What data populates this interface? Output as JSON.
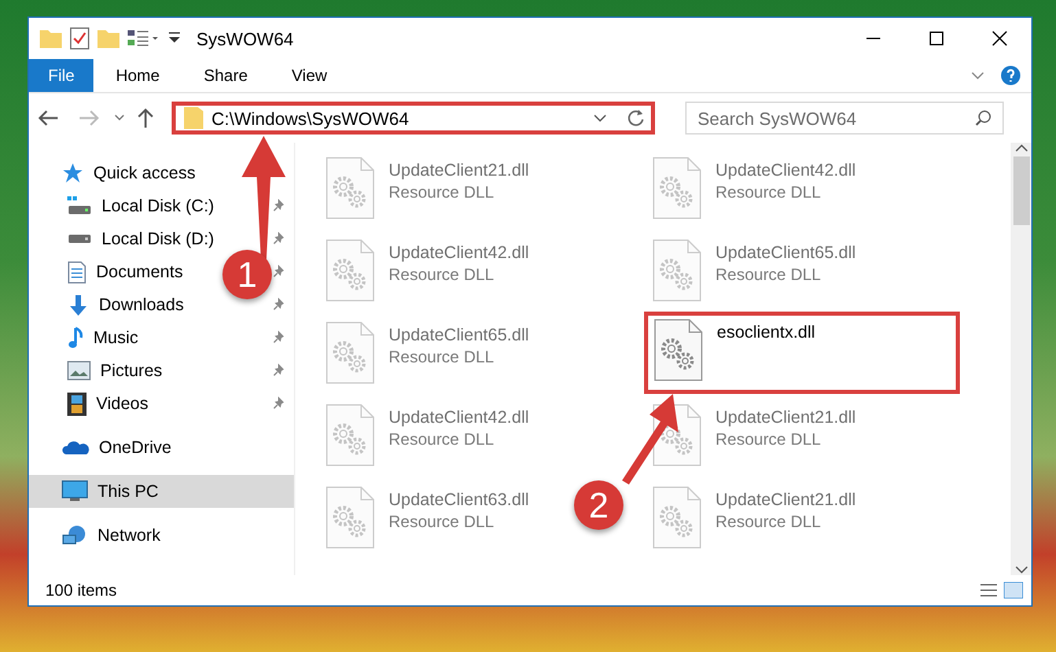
{
  "window": {
    "title": "SysWOW64"
  },
  "ribbon_tabs": [
    {
      "label": "File",
      "kind": "file"
    },
    {
      "label": "Home",
      "kind": "tab"
    },
    {
      "label": "Share",
      "kind": "tab"
    },
    {
      "label": "View",
      "kind": "tab"
    }
  ],
  "address": {
    "path": "C:\\Windows\\SysWOW64",
    "highlighted": true
  },
  "search": {
    "placeholder": "Search SysWOW64"
  },
  "sidebar": {
    "items": [
      {
        "label": "Quick access",
        "selected": false,
        "children": [
          {
            "label": "Local Disk (C:)",
            "pinned": true,
            "selected": false
          },
          {
            "label": "Local Disk (D:)",
            "pinned": true,
            "selected": false
          },
          {
            "label": "Documents",
            "pinned": true,
            "selected": false
          },
          {
            "label": "Downloads",
            "pinned": true,
            "selected": false
          },
          {
            "label": "Music",
            "pinned": true,
            "selected": false
          },
          {
            "label": "Pictures",
            "pinned": true,
            "selected": false
          },
          {
            "label": "Videos",
            "pinned": true,
            "selected": false
          }
        ]
      },
      {
        "label": "OneDrive",
        "selected": false
      },
      {
        "label": "This PC",
        "selected": true
      },
      {
        "label": "Network",
        "selected": false
      }
    ]
  },
  "files": [
    {
      "name": "UpdateClient21.dll",
      "type": "Resource DLL",
      "faded": true,
      "highlighted": false
    },
    {
      "name": "UpdateClient42.dll",
      "type": "Resource DLL",
      "faded": true,
      "highlighted": false
    },
    {
      "name": "UpdateClient42.dll",
      "type": "Resource DLL",
      "faded": true,
      "highlighted": false
    },
    {
      "name": "UpdateClient65.dll",
      "type": "Resource DLL",
      "faded": true,
      "highlighted": false
    },
    {
      "name": "UpdateClient65.dll",
      "type": "Resource DLL",
      "faded": true,
      "highlighted": false
    },
    {
      "name": "esoclientx.dll",
      "faded": false,
      "highlighted": true
    },
    {
      "name": "UpdateClient42.dll",
      "type": "Resource DLL",
      "faded": true,
      "highlighted": false
    },
    {
      "name": "UpdateClient21.dll",
      "type": "Resource DLL",
      "faded": true,
      "highlighted": false
    },
    {
      "name": "UpdateClient63.dll",
      "type": "Resource DLL",
      "faded": true,
      "highlighted": false
    },
    {
      "name": "UpdateClient21.dll",
      "type": "Resource DLL",
      "faded": true,
      "highlighted": false
    }
  ],
  "status_bar": {
    "count": "100 items"
  },
  "callouts": [
    {
      "number": "1"
    },
    {
      "number": "2"
    }
  ]
}
